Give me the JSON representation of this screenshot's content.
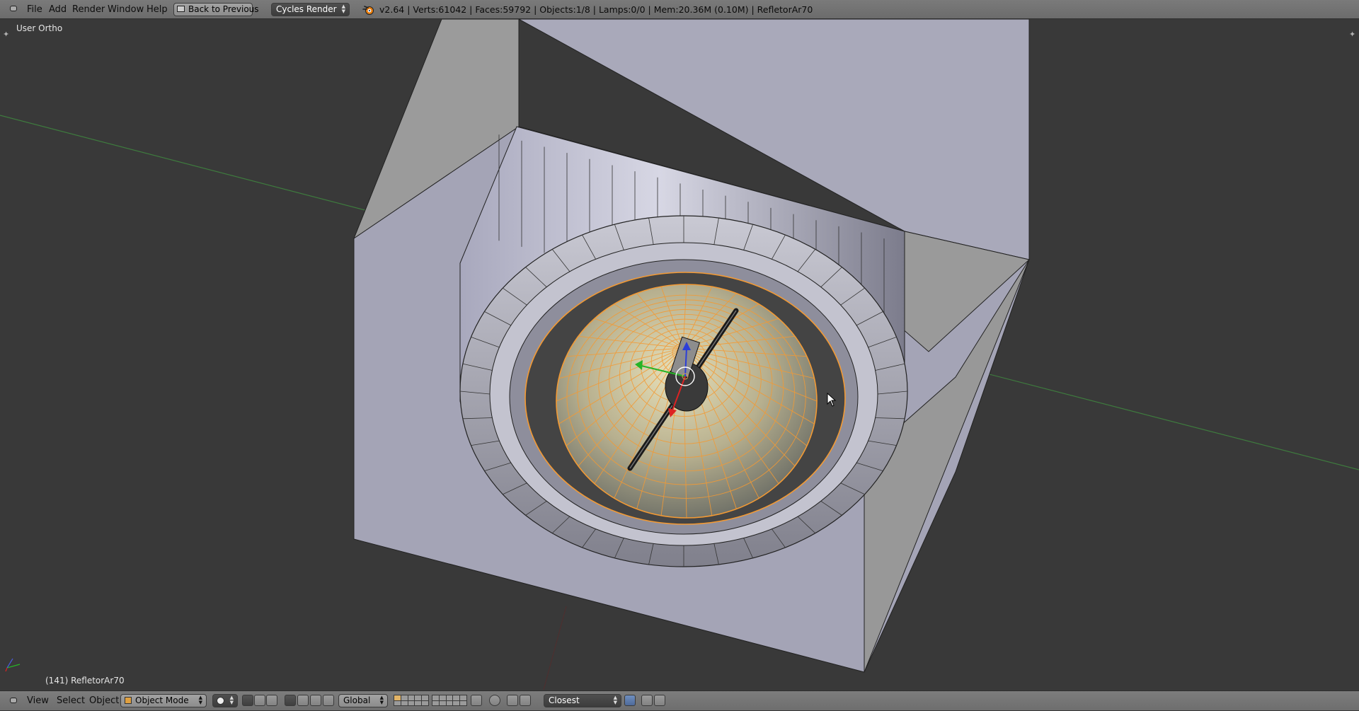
{
  "header": {
    "menus": [
      "File",
      "Add",
      "Render",
      "Window",
      "Help"
    ],
    "back_button": "Back to Previous",
    "render_engine": "Cycles Render",
    "stats": "v2.64 | Verts:61042 | Faces:59792 | Objects:1/8 | Lamps:0/0 | Mem:20.36M (0.10M) | RefletorAr70"
  },
  "viewport": {
    "view_name": "User Ortho",
    "active_object": "(141) RefletorAr70"
  },
  "footer": {
    "menus": [
      "View",
      "Select",
      "Object"
    ],
    "mode": "Object Mode",
    "transform_orientation": "Global",
    "snap_target": "Closest"
  },
  "icons": {
    "editor_type": "editor-type-icon",
    "blender_logo": "blender-logo-icon",
    "shading": "solid-sphere-icon",
    "pivot": "pivot-icon",
    "manipulator": "manipulator-icon",
    "proportional": "proportional-edit-icon",
    "snap": "magnet-icon",
    "render": "camera-render-icon"
  },
  "colors": {
    "viewport_bg": "#393939",
    "header_bg": "#727272",
    "selection_outline": "#f39a34",
    "x_axis": "#7a2c2c",
    "y_axis": "#3d7a3d"
  }
}
